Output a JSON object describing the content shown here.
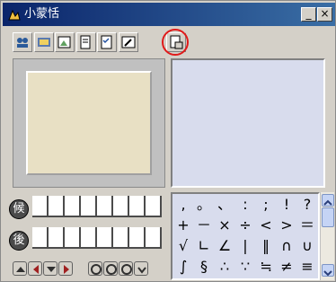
{
  "window": {
    "title": "小蒙恬",
    "minimize_label": "_",
    "close_label": "×"
  },
  "toolbar": {
    "buttons": [
      {
        "icon": "users-icon"
      },
      {
        "icon": "settings-icon"
      },
      {
        "icon": "image-icon"
      },
      {
        "icon": "document-icon"
      },
      {
        "icon": "checklist-icon"
      },
      {
        "icon": "tool-icon"
      },
      {
        "icon": "export-document-icon"
      }
    ],
    "highlighted": "export-document-icon"
  },
  "candidates": {
    "before_label": "候",
    "after_label": "後"
  },
  "symbols": [
    [
      ",",
      "。",
      "、",
      ":",
      ";",
      "!",
      "?"
    ],
    [
      "+",
      "－",
      "×",
      "÷",
      "<",
      ">",
      "＝"
    ],
    [
      "√",
      "∟",
      "∠",
      "|",
      "‖",
      "∩",
      "∪"
    ],
    [
      "∫",
      "§",
      "∴",
      "∵",
      "≒",
      "≠",
      "≡"
    ]
  ],
  "colors": {
    "highlight_ring": "#e01a1a",
    "title_bar": "#0a246a",
    "pad_background": "#e8e0c4",
    "panel_blue": "#d8dced"
  }
}
